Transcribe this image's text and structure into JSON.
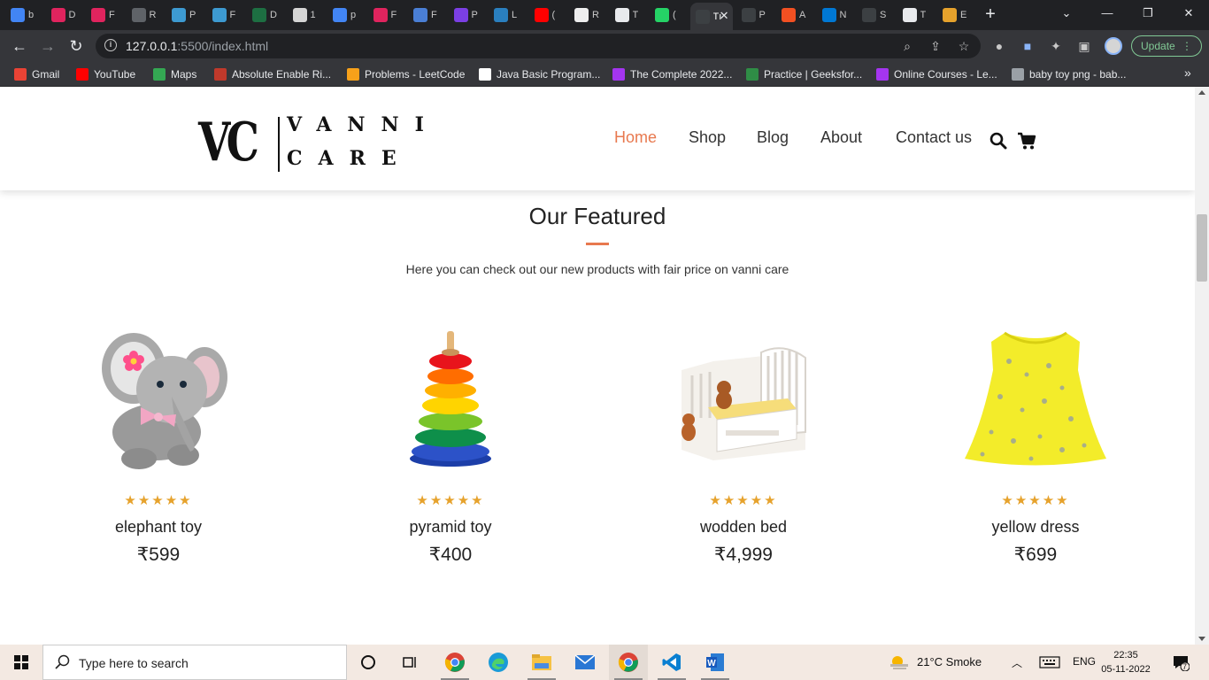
{
  "browser": {
    "tabs": [
      {
        "letter": "b",
        "color": "#4285f4"
      },
      {
        "letter": "D",
        "color": "#e0245e"
      },
      {
        "letter": "F",
        "color": "#e0245e"
      },
      {
        "letter": "R",
        "color": "#5f6368"
      },
      {
        "letter": "P",
        "color": "#3d9ad1"
      },
      {
        "letter": "F",
        "color": "#3d9ad1"
      },
      {
        "letter": "D",
        "color": "#1d6f42"
      },
      {
        "letter": "1",
        "color": "#d5d5d5"
      },
      {
        "letter": "p",
        "color": "#4285f4"
      },
      {
        "letter": "F",
        "color": "#e0245e"
      },
      {
        "letter": "F",
        "color": "#4a7fd6"
      },
      {
        "letter": "P",
        "color": "#7b3fe4"
      },
      {
        "letter": "L",
        "color": "#2a7fbf"
      },
      {
        "letter": "(",
        "color": "#ff0000"
      },
      {
        "letter": "R",
        "color": "#eeeeee"
      },
      {
        "letter": "T",
        "color": "#e8eaed"
      },
      {
        "letter": "(",
        "color": "#25d366"
      },
      {
        "letter": "Tı",
        "color": "#3c4043",
        "active": true
      },
      {
        "letter": "P",
        "color": "#3c4043"
      },
      {
        "letter": "A",
        "color": "#f25022"
      },
      {
        "letter": "N",
        "color": "#0078d4"
      },
      {
        "letter": "S",
        "color": "#3c4043"
      },
      {
        "letter": "T",
        "color": "#e8eaed"
      },
      {
        "letter": "E",
        "color": "#e6a22c"
      }
    ],
    "url_host": "127.0.0.1",
    "url_rest": ":5500/index.html",
    "update_label": "Update",
    "bookmarks": [
      {
        "label": "Gmail",
        "color": "#ea4335"
      },
      {
        "label": "YouTube",
        "color": "#ff0000"
      },
      {
        "label": "Maps",
        "color": "#34a853"
      },
      {
        "label": "Absolute Enable Ri...",
        "color": "#c0392b"
      },
      {
        "label": "Problems - LeetCode",
        "color": "#f7a11a"
      },
      {
        "label": "Java Basic Program...",
        "color": "#ffffff"
      },
      {
        "label": "The Complete 2022...",
        "color": "#a435f0"
      },
      {
        "label": "Practice | Geeksfor...",
        "color": "#2f8d46"
      },
      {
        "label": "Online Courses - Le...",
        "color": "#a435f0"
      },
      {
        "label": "baby toy png - bab...",
        "color": "#9aa0a6"
      }
    ]
  },
  "site": {
    "logo": {
      "mark": "VC",
      "word1": "VANNI",
      "word2": "CARE"
    },
    "nav": [
      "Home",
      "Shop",
      "Blog",
      "About",
      "Contact us"
    ],
    "section_title": "Our Featured",
    "section_subtitle": "Here you can check out our new products with fair price on vanni care",
    "products": [
      {
        "name": "elephant toy",
        "price": "₹599",
        "rating": 5
      },
      {
        "name": "pyramid toy",
        "price": "₹400",
        "rating": 5
      },
      {
        "name": "wodden bed",
        "price": "₹4,999",
        "rating": 5
      },
      {
        "name": "yellow dress",
        "price": "₹699",
        "rating": 5
      }
    ],
    "accent_color": "#e8794f",
    "star_color": "#e6a22c"
  },
  "taskbar": {
    "search_placeholder": "Type here to search",
    "weather": "21°C  Smoke",
    "language": "ENG",
    "time": "22:35",
    "date": "05-11-2022",
    "notification_count": "7"
  }
}
